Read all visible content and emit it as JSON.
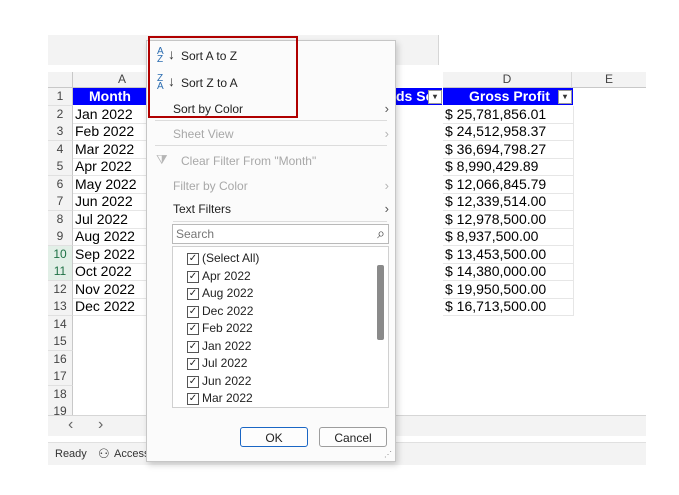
{
  "columns": [
    "A",
    "D",
    "E"
  ],
  "header": {
    "month": "Month",
    "hidden_col_partial": "ds So",
    "gross_profit": "Gross Profit"
  },
  "row_numbers": [
    "1",
    "2",
    "3",
    "4",
    "5",
    "6",
    "7",
    "8",
    "9",
    "10",
    "11",
    "12",
    "13",
    "14",
    "15",
    "16",
    "17",
    "18",
    "19"
  ],
  "months": [
    "Jan 2022",
    "Feb 2022",
    "Mar 2022",
    "Apr 2022",
    "May 2022",
    "Jun 2022",
    "Jul 2022",
    "Aug 2022",
    "Sep 2022",
    "Oct 2022",
    "Nov 2022",
    "Dec 2022"
  ],
  "profits": [
    "$ 25,781,856.01",
    "$ 24,512,958.37",
    "$ 36,694,798.27",
    "$ 8,990,429.89",
    "$ 12,066,845.79",
    "$ 12,339,514.00",
    "$ 12,978,500.00",
    "$ 8,937,500.00",
    "$ 13,453,500.00",
    "$ 14,380,000.00",
    "$ 19,950,500.00",
    "$ 16,713,500.00"
  ],
  "status": {
    "ready": "Ready",
    "accessibility": "Accessi"
  },
  "nav": {
    "prev": "‹",
    "next": "›"
  },
  "menu": {
    "sort_az": "Sort A to Z",
    "sort_za": "Sort Z to A",
    "sort_by_color": "Sort by Color",
    "sheet_view": "Sheet View",
    "clear_filter": "Clear Filter From \"Month\"",
    "filter_by_color": "Filter by Color",
    "text_filters": "Text Filters",
    "search_placeholder": "Search",
    "list_items": [
      "(Select All)",
      "Apr 2022",
      "Aug 2022",
      "Dec 2022",
      "Feb 2022",
      "Jan 2022",
      "Jul 2022",
      "Jun 2022",
      "Mar 2022"
    ],
    "ok": "OK",
    "cancel": "Cancel"
  },
  "colors": {
    "header_fill": "#0000ff",
    "highlight_box": "#b00000",
    "selected_row_text": "#1e7145"
  }
}
